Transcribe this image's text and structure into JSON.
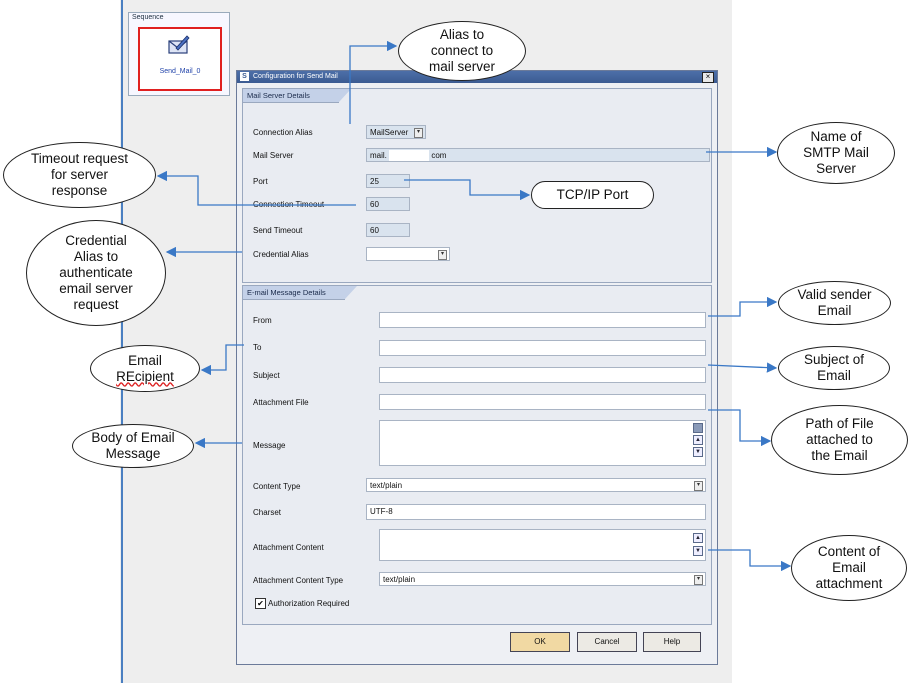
{
  "sequence": {
    "title": "Sequence",
    "item_label": "Send_Mail_0"
  },
  "dialog": {
    "title": "Configuration for Send Mail",
    "close_glyph": "×",
    "server_section": {
      "tab": "Mail Server Details",
      "connection_alias_label": "Connection Alias",
      "connection_alias_value": "MailServer",
      "mail_server_label": "Mail Server",
      "mail_server_value_prefix": "mail.",
      "mail_server_value_suffix": "com",
      "port_label": "Port",
      "port_value": "25",
      "connection_timeout_label": "Connection Timeout",
      "connection_timeout_value": "60",
      "send_timeout_label": "Send Timeout",
      "send_timeout_value": "60",
      "credential_alias_label": "Credential Alias",
      "credential_alias_value": ""
    },
    "message_section": {
      "tab": "E-mail Message Details",
      "from_label": "From",
      "to_label": "To",
      "subject_label": "Subject",
      "attachment_file_label": "Attachment File",
      "message_label": "Message",
      "content_type_label": "Content Type",
      "content_type_value": "text/plain",
      "charset_label": "Charset",
      "charset_value": "UTF-8",
      "attachment_content_label": "Attachment Content",
      "attachment_content_type_label": "Attachment Content Type",
      "attachment_content_type_value": "text/plain",
      "auth_label": "Authorization Required",
      "auth_checked": true
    },
    "buttons": {
      "ok": "OK",
      "cancel": "Cancel",
      "help": "Help"
    }
  },
  "annotations": {
    "alias": [
      "Alias to",
      "connect to",
      "mail server"
    ],
    "smtp": [
      "Name of",
      "SMTP Mail",
      "Server"
    ],
    "timeout": [
      "Timeout request",
      "for server",
      "response"
    ],
    "tcp": "TCP/IP Port",
    "credential": [
      "Credential",
      "Alias to",
      "authenticate",
      "email server",
      "request"
    ],
    "sender": [
      "Valid sender",
      "Email"
    ],
    "recipient": [
      "Email",
      "REcipient"
    ],
    "subject": [
      "Subject of",
      "Email"
    ],
    "path": [
      "Path of File",
      "attached to",
      "the Email"
    ],
    "body": [
      "Body of Email",
      "Message"
    ],
    "content": [
      "Content of",
      "Email",
      "attachment"
    ]
  },
  "colors": {
    "arrow": "#3a78c6",
    "highlight": "#e02020",
    "titlebar": "#3b5b92"
  }
}
